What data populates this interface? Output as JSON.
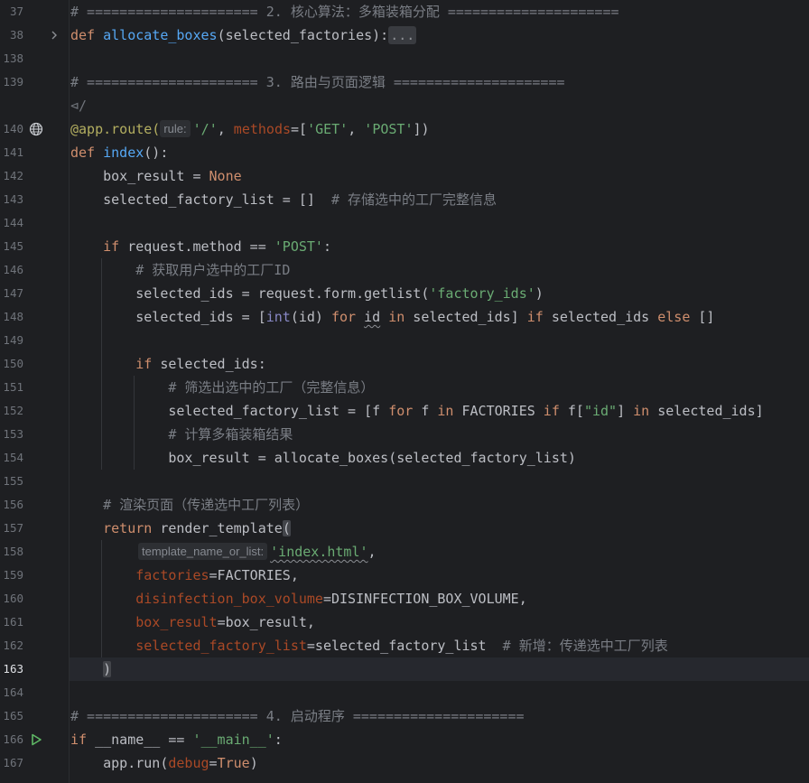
{
  "lines": [
    {
      "n": "37",
      "c": "# ===================== 2. 核心算法：多箱装箱分配 ====================="
    },
    {
      "n": "38",
      "c": "def allocate_boxes(selected_factories):..."
    },
    {
      "n": "138",
      "c": ""
    },
    {
      "n": "139",
      "c": "# ===================== 3. 路由与页面逻辑 ====================="
    },
    {
      "n": "",
      "c": "⊲/"
    },
    {
      "n": "140",
      "c": "@app.route( rule: '/', methods=['GET', 'POST'])"
    },
    {
      "n": "141",
      "c": "def index():"
    },
    {
      "n": "142",
      "c": "    box_result = None"
    },
    {
      "n": "143",
      "c": "    selected_factory_list = []  # 存储选中的工厂完整信息"
    },
    {
      "n": "144",
      "c": ""
    },
    {
      "n": "145",
      "c": "    if request.method == 'POST':"
    },
    {
      "n": "146",
      "c": "        # 获取用户选中的工厂ID"
    },
    {
      "n": "147",
      "c": "        selected_ids = request.form.getlist('factory_ids')"
    },
    {
      "n": "148",
      "c": "        selected_ids = [int(id) for id in selected_ids] if selected_ids else []"
    },
    {
      "n": "149",
      "c": ""
    },
    {
      "n": "150",
      "c": "        if selected_ids:"
    },
    {
      "n": "151",
      "c": "            # 筛选出选中的工厂（完整信息）"
    },
    {
      "n": "152",
      "c": "            selected_factory_list = [f for f in FACTORIES if f[\"id\"] in selected_ids]"
    },
    {
      "n": "153",
      "c": "            # 计算多箱装箱结果"
    },
    {
      "n": "154",
      "c": "            box_result = allocate_boxes(selected_factory_list)"
    },
    {
      "n": "155",
      "c": ""
    },
    {
      "n": "156",
      "c": "    # 渲染页面（传递选中工厂列表）"
    },
    {
      "n": "157",
      "c": "    return render_template("
    },
    {
      "n": "158",
      "c": "         template_name_or_list: 'index.html',"
    },
    {
      "n": "159",
      "c": "        factories=FACTORIES,"
    },
    {
      "n": "160",
      "c": "        disinfection_box_volume=DISINFECTION_BOX_VOLUME,"
    },
    {
      "n": "161",
      "c": "        box_result=box_result,"
    },
    {
      "n": "162",
      "c": "        selected_factory_list=selected_factory_list  # 新增：传递选中工厂列表"
    },
    {
      "n": "163",
      "c": "    )"
    },
    {
      "n": "164",
      "c": ""
    },
    {
      "n": "165",
      "c": "# ===================== 4. 启动程序 ====================="
    },
    {
      "n": "166",
      "c": "if __name__ == '__main__':"
    },
    {
      "n": "167",
      "c": "    app.run(debug=True)"
    }
  ],
  "tokens": {
    "l37": "# ===================== 2. 核心算法：多箱装箱分配 =====================",
    "l38_def": "def ",
    "l38_fn": "allocate_boxes",
    "l38_rest": "(selected_factories):",
    "l38_fold": "...",
    "l139": "# ===================== 3. 路由与页面逻辑 =====================",
    "l139b": "⊲/",
    "l140_deco": "@app.route(",
    "l140_hint": "rule:",
    "l140_s1": "'/'",
    "l140_c1": ", ",
    "l140_kw": "methods",
    "l140_c2": "=[",
    "l140_s2": "'GET'",
    "l140_c3": ", ",
    "l140_s3": "'POST'",
    "l140_c4": "])",
    "l141_def": "def ",
    "l141_fn": "index",
    "l141_rest": "():",
    "l142_a": "    box_result = ",
    "l142_b": "None",
    "l143_a": "    selected_factory_list = []  ",
    "l143_cm": "# 存储选中的工厂完整信息",
    "l145_if": "    if ",
    "l145_a": "request.method == ",
    "l145_s": "'POST'",
    "l145_b": ":",
    "l146": "        # 获取用户选中的工厂ID",
    "l147_a": "        selected_ids = request.form.getlist(",
    "l147_s": "'factory_ids'",
    "l147_b": ")",
    "l148_a": "        selected_ids = [",
    "l148_int": "int",
    "l148_b": "(id) ",
    "l148_for": "for",
    "l148_c": " ",
    "l148_id": "id",
    "l148_d": " ",
    "l148_in": "in",
    "l148_e": " selected_ids] ",
    "l148_if": "if",
    "l148_f": " selected_ids ",
    "l148_else": "else",
    "l148_g": " []",
    "l150_if": "        if ",
    "l150_a": "selected_ids:",
    "l151": "            # 筛选出选中的工厂（完整信息）",
    "l152_a": "            selected_factory_list = [f ",
    "l152_for": "for",
    "l152_b": " f ",
    "l152_in": "in",
    "l152_c": " FACTORIES ",
    "l152_if": "if",
    "l152_d": " f[",
    "l152_s": "\"id\"",
    "l152_e": "] ",
    "l152_in2": "in",
    "l152_f": " selected_ids]",
    "l153": "            # 计算多箱装箱结果",
    "l154": "            box_result = allocate_boxes(selected_factory_list)",
    "l156": "    # 渲染页面（传递选中工厂列表）",
    "l157_ret": "    return ",
    "l157_a": "render_template",
    "l157_p": "(",
    "l158_hint": "template_name_or_list:",
    "l158_s": "'index.html'",
    "l158_b": ",",
    "l159_k": "        factories",
    "l159_v": "=FACTORIES,",
    "l160_k": "        disinfection_box_volume",
    "l160_v": "=DISINFECTION_BOX_VOLUME,",
    "l161_k": "        box_result",
    "l161_v": "=box_result,",
    "l162_k": "        selected_factory_list",
    "l162_v": "=selected_factory_list  ",
    "l162_cm": "# 新增：传递选中工厂列表",
    "l163_a": "    ",
    "l163_p": ")",
    "l165": "# ===================== 4. 启动程序 =====================",
    "l166_if": "if ",
    "l166_a": "__name__ == ",
    "l166_s": "'__main__'",
    "l166_b": ":",
    "l167_a": "    app.run(",
    "l167_k": "debug",
    "l167_b": "=",
    "l167_t": "True",
    "l167_c": ")"
  },
  "line_numbers": [
    "37",
    "38",
    "138",
    "139",
    "",
    "140",
    "141",
    "142",
    "143",
    "144",
    "145",
    "146",
    "147",
    "148",
    "149",
    "150",
    "151",
    "152",
    "153",
    "154",
    "155",
    "156",
    "157",
    "158",
    "159",
    "160",
    "161",
    "162",
    "163",
    "164",
    "165",
    "166",
    "167"
  ],
  "icons": {
    "fold": "chevron-right-icon",
    "web": "globe-icon",
    "run": "run-play-icon"
  },
  "colors": {
    "background": "#1e1f22",
    "keyword": "#cf8e6d",
    "function": "#56a8f5",
    "string": "#6aab73",
    "comment": "#7a7e85",
    "run_icon": "#5fb865"
  }
}
